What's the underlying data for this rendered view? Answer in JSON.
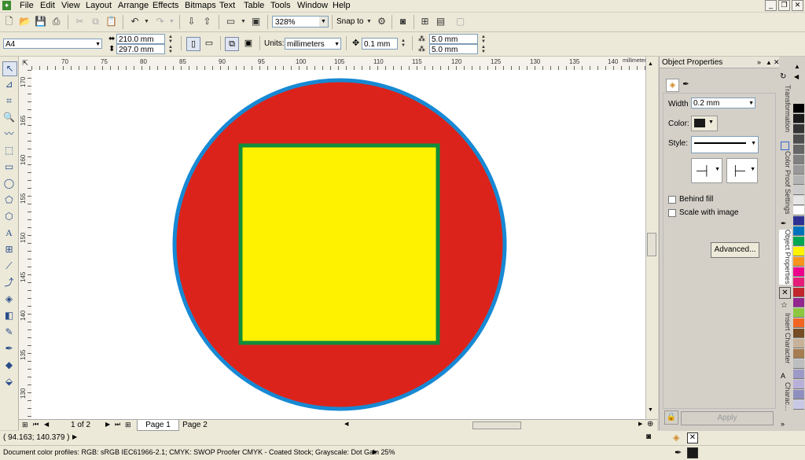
{
  "menu": {
    "items": [
      "File",
      "Edit",
      "View",
      "Layout",
      "Arrange",
      "Effects",
      "Bitmaps",
      "Text",
      "Table",
      "Tools",
      "Window",
      "Help"
    ]
  },
  "toolbar": {
    "zoom": "328%",
    "snap_to": "Snap to"
  },
  "propbar": {
    "paper_size": "A4",
    "width": "210.0 mm",
    "height": "297.0 mm",
    "units_label": "Units:",
    "units_value": "millimeters",
    "nudge": "0.1 mm",
    "dup_x": "5.0 mm",
    "dup_y": "5.0 mm"
  },
  "rulers": {
    "h_unit": "millimeters",
    "v_unit": "millimeters",
    "h_ticks": [
      "70",
      "75",
      "80",
      "85",
      "90",
      "95",
      "100",
      "105",
      "110",
      "115",
      "120",
      "125",
      "130",
      "135",
      "140"
    ],
    "v_ticks": [
      "170",
      "165",
      "160",
      "155",
      "150",
      "145",
      "140",
      "135",
      "130"
    ]
  },
  "pagebar": {
    "page_count": "1 of 2",
    "tabs": [
      "Page 1",
      "Page 2"
    ]
  },
  "status": {
    "coords": "( 94.163; 140.379 )",
    "color_profiles": "Document color profiles: RGB: sRGB IEC61966-2.1; CMYK: SWOP Proofer CMYK - Coated Stock; Grayscale: Dot Gain 25%"
  },
  "docker": {
    "title": "Object Properties",
    "width_label": "Width",
    "width_value": "0.2 mm",
    "color_label": "Color:",
    "style_label": "Style:",
    "behind_fill": "Behind fill",
    "scale_with_image": "Scale with image",
    "advanced_button": "Advanced...",
    "apply_button": "Apply",
    "side_tabs": [
      "Transformation",
      "Color Proof Settings",
      "Object Properties",
      "Insert Character",
      "Charac..."
    ]
  },
  "shapes": {
    "circle_fill": "#dc231b",
    "circle_outline": "#1789d4",
    "square_fill": "#fff200",
    "square_outline": "#118c3a"
  },
  "palette": [
    "#ffffff",
    "#000000",
    "#1a1a1a",
    "#333333",
    "#4d4d4d",
    "#666666",
    "#808080",
    "#999999",
    "#b3b3b3",
    "#cccccc",
    "#e6e6e6",
    "#ffffff",
    "#2e3192",
    "#0072bc",
    "#00a651",
    "#fff200",
    "#f7941d",
    "#ec008c",
    "#e41e79",
    "#c1272d",
    "#92278f",
    "#8dc63f",
    "#f26522",
    "#754c24",
    "#c7b299",
    "#a67c52",
    "#bcbec0",
    "#9e9ac8",
    "#b8b0d8",
    "#8f8fbf",
    "#c8c8e6"
  ]
}
